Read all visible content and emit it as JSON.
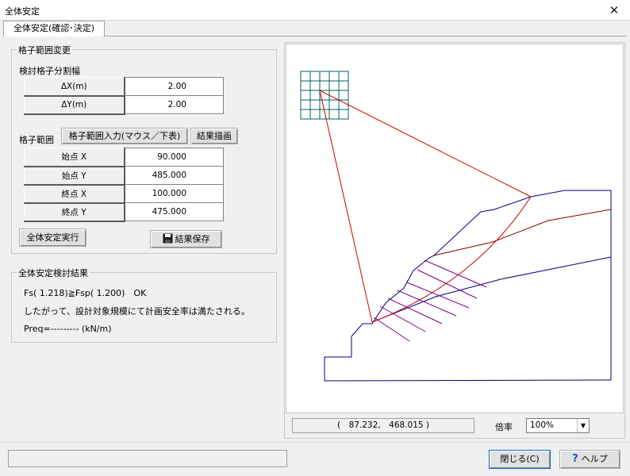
{
  "window": {
    "title": "全体安定",
    "close_glyph": "✕"
  },
  "tab": {
    "label": "全体安定(確認･決定)"
  },
  "grid_change": {
    "legend": "格子範囲変更",
    "subtitle": "検討格子分割幅",
    "rows": [
      {
        "label": "ΔX(m)",
        "value": "2.00"
      },
      {
        "label": "ΔY(m)",
        "value": "2.00"
      }
    ]
  },
  "grid_range": {
    "label": "格子範囲",
    "input_button": "格子範囲入力(マウス／下表)",
    "draw_button": "結果描画",
    "rows": [
      {
        "label": "始点 X",
        "value": "90.000"
      },
      {
        "label": "始点 Y",
        "value": "485.000"
      },
      {
        "label": "終点 X",
        "value": "100.000"
      },
      {
        "label": "終点 Y",
        "value": "475.000"
      }
    ]
  },
  "actions": {
    "run": "全体安定実行",
    "save": "結果保存",
    "save_icon": "floppy-disk-icon"
  },
  "result": {
    "legend": "全体安定検討結果",
    "line1": "Fs( 1.218)≧Fsp( 1.200)　OK",
    "line2": "したがって、設計対象規模にて計画安全率は満たされる。",
    "line3": "Preq=--------- (kN/m)"
  },
  "canvas_footer": {
    "coordinates": "(　87.232,　468.015 )",
    "zoom_label": "倍率",
    "zoom_value": "100%"
  },
  "footer": {
    "close": "閉じる(C)",
    "help": "ヘルプ",
    "help_icon": "question-icon"
  },
  "colors": {
    "slope": "#00007f",
    "slip": "#cc0000",
    "grid": "#006060",
    "slices": "#800080",
    "layer": "#800000"
  }
}
